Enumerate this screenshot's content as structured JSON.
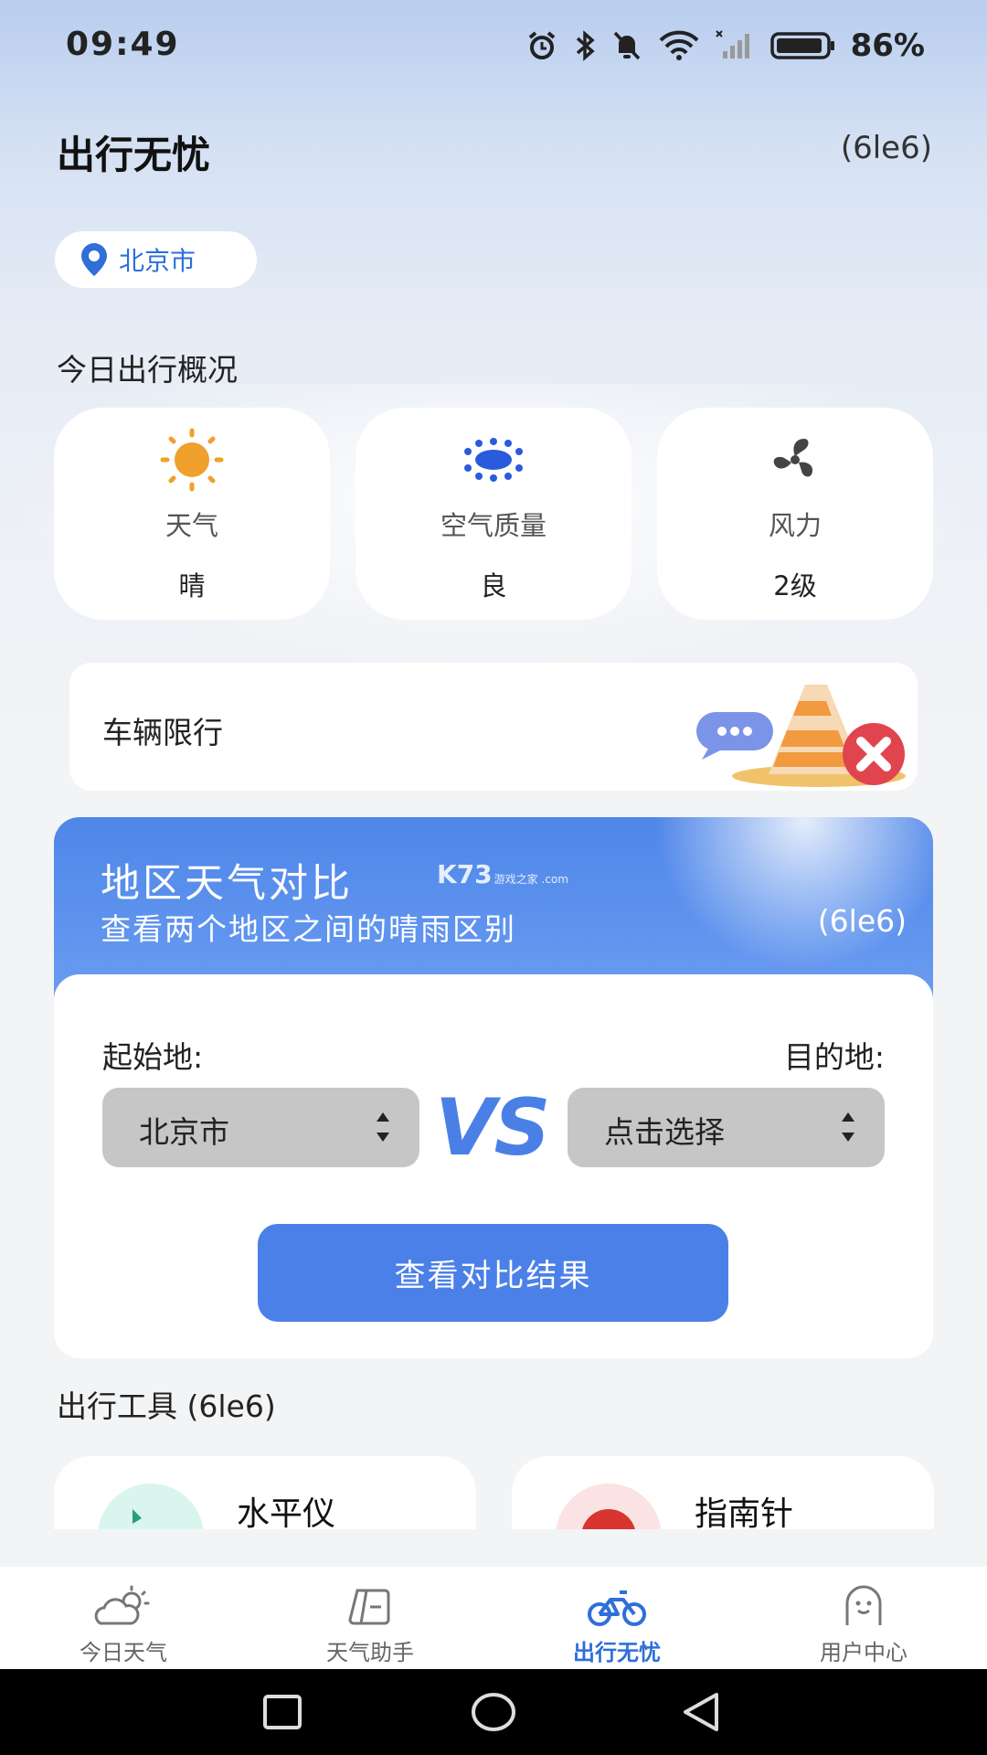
{
  "status_bar": {
    "time": "09:49",
    "battery": "86%"
  },
  "header": {
    "title": "出行无忧",
    "version": "(6le6)"
  },
  "location": {
    "city": "北京市"
  },
  "overview": {
    "title": "今日出行概况",
    "cards": [
      {
        "icon": "sun-icon",
        "label": "天气",
        "value": "晴"
      },
      {
        "icon": "air-quality-icon",
        "label": "空气质量",
        "value": "良"
      },
      {
        "icon": "fan-icon",
        "label": "风力",
        "value": "2级"
      }
    ]
  },
  "restriction": {
    "label": "车辆限行"
  },
  "compare": {
    "title": "地区天气对比",
    "subtitle": "查看两个地区之间的晴雨区别",
    "version": "(6le6)",
    "watermark": "K73",
    "watermark_sub": "游戏之家 .com",
    "from_label": "起始地:",
    "to_label": "目的地:",
    "from_value": "北京市",
    "to_value": "点击选择",
    "vs": "VS",
    "button": "查看对比结果"
  },
  "tools": {
    "title": "出行工具 (6le6)",
    "items": [
      {
        "name": "水平仪",
        "color": "#d9f5ee"
      },
      {
        "name": "指南针",
        "color": "#fbe3e3"
      }
    ]
  },
  "tabs": [
    {
      "label": "今日天气",
      "icon": "cloud-sun-icon",
      "active": false
    },
    {
      "label": "天气助手",
      "icon": "assistant-icon",
      "active": false
    },
    {
      "label": "出行无忧",
      "icon": "bicycle-icon",
      "active": true
    },
    {
      "label": "用户中心",
      "icon": "user-icon",
      "active": false
    }
  ],
  "colors": {
    "accent": "#4c80e9",
    "active_tab": "#2f6fd7"
  }
}
